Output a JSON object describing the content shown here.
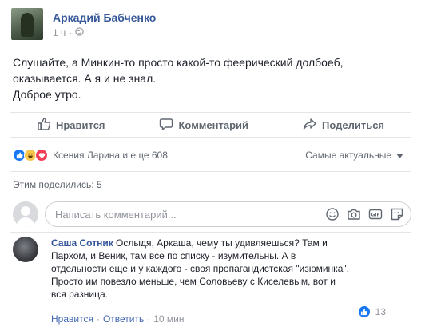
{
  "post": {
    "author": "Аркадий Бабченко",
    "time": "1 ч",
    "dot": "·",
    "lines": [
      "Слушайте, а Минкин-то просто какой-то феерический долбоеб,",
      "оказывается. А я и не знал.",
      "Доброе утро."
    ]
  },
  "actions": {
    "like": "Нравится",
    "comment": "Комментарий",
    "share": "Поделиться"
  },
  "reactions": {
    "text": "Ксения Ларина и еще 608",
    "sort_label": "Самые актуальные"
  },
  "shares": "Этим поделились: 5",
  "comment_input": {
    "placeholder": "Написать комментарий..."
  },
  "comment": {
    "author": "Саша Сотник",
    "first_line": "Ослыдя, Аркаша, чему ты удивляешься? Там и",
    "lines": [
      "Пархом, и Веник, там все по списку - изумительны. А в",
      "отдельности еще и у каждого - своя пропагандистская \"изюминка\".",
      "Просто им повезло меньше, чем Соловьеву с Киселевым, вот и",
      "вся разница."
    ],
    "like_label": "Нравится",
    "reply_label": "Ответить",
    "time": "10 мин",
    "dot": "·",
    "like_count": "13"
  },
  "colors": {
    "link": "#365899",
    "like_blue": "#1877f2",
    "haha_yellow": "#f7c64b",
    "love_red": "#f33e58"
  },
  "icons": [
    "globe-icon",
    "thumbs-up-icon",
    "speech-bubble-icon",
    "share-arrow-icon",
    "dropdown-caret-icon",
    "emoji-icon",
    "camera-icon",
    "gif-icon",
    "sticker-icon"
  ]
}
